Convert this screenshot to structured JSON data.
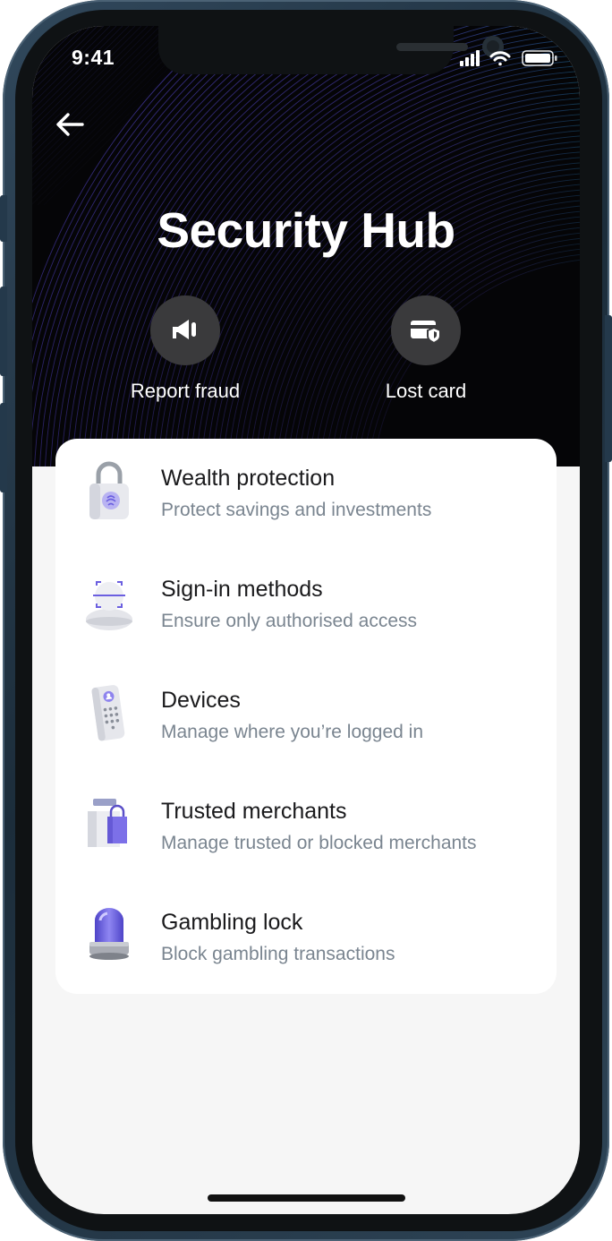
{
  "status_bar": {
    "time": "9:41"
  },
  "header": {
    "title": "Security Hub",
    "back_icon": "arrow-left-icon"
  },
  "quick_actions": [
    {
      "label": "Report fraud",
      "icon": "megaphone-icon"
    },
    {
      "label": "Lost card",
      "icon": "card-shield-icon"
    }
  ],
  "items": [
    {
      "title": "Wealth protection",
      "subtitle": "Protect savings and investments",
      "icon": "padlock-icon"
    },
    {
      "title": "Sign-in methods",
      "subtitle": "Ensure only authorised access",
      "icon": "face-scan-icon"
    },
    {
      "title": "Devices",
      "subtitle": "Manage where you’re logged in",
      "icon": "phone-keypad-icon"
    },
    {
      "title": "Trusted merchants",
      "subtitle": "Manage trusted or blocked merchants",
      "icon": "shopping-bag-icon"
    },
    {
      "title": "Gambling lock",
      "subtitle": "Block gambling transactions",
      "icon": "siren-light-icon"
    }
  ],
  "colors": {
    "hero_background": "#050507",
    "accent_purple": "#6b5fe0",
    "accent_teal": "#1fd4a8",
    "card_background": "#ffffff",
    "screen_background": "#f6f6f6",
    "subtitle_text": "#7a8590"
  }
}
